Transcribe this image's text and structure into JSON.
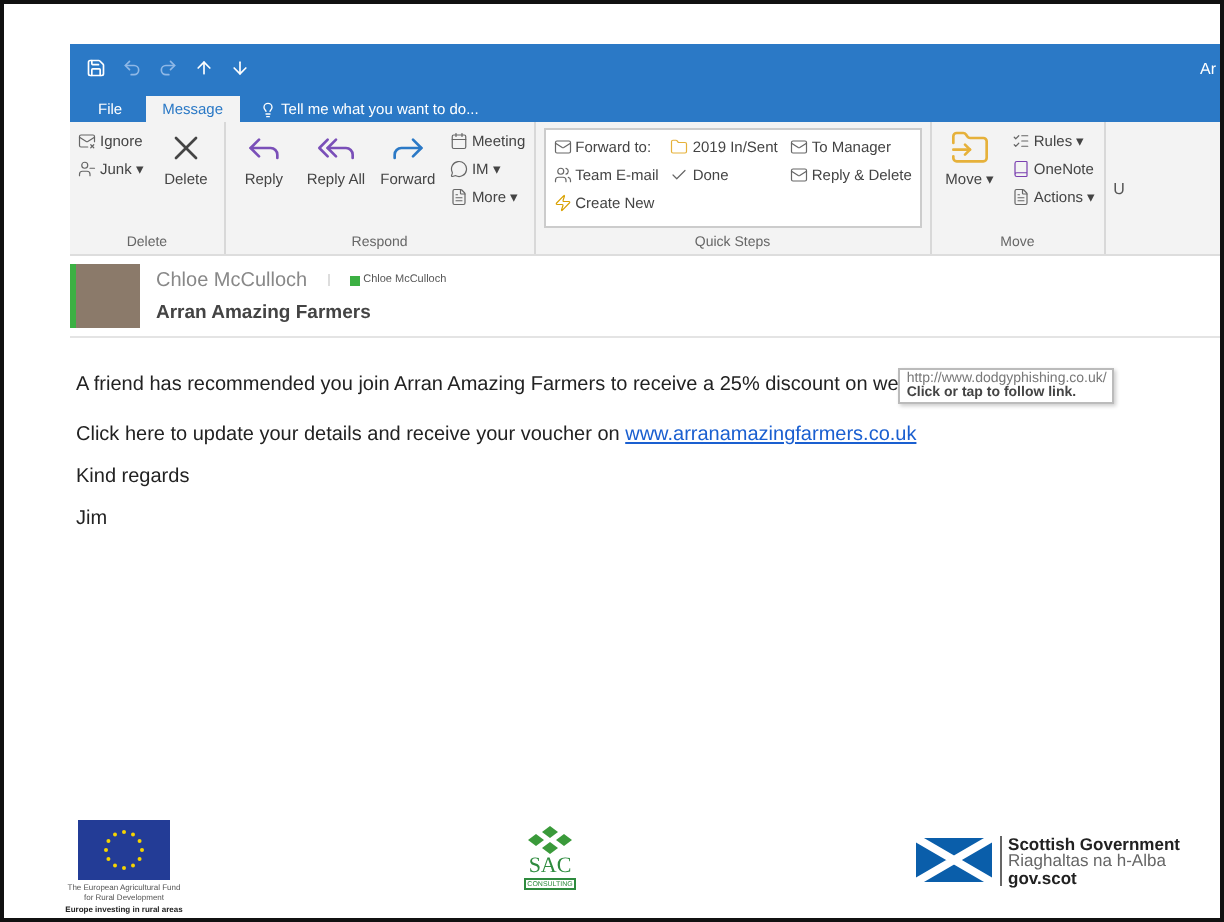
{
  "title_fragment": "Ar",
  "tabs": [
    {
      "label": "File",
      "selected": false
    },
    {
      "label": "Message",
      "selected": true
    }
  ],
  "tell_me": "Tell me what you want to do...",
  "ribbon_groups": [
    {
      "label": "Delete",
      "kind": "plain",
      "columns": [
        [
          {
            "label": "Ignore",
            "kind": "small"
          },
          {
            "label": "Junk ▾",
            "kind": "small"
          }
        ],
        [
          {
            "label": "Delete",
            "kind": "large"
          }
        ]
      ]
    },
    {
      "label": "Respond",
      "kind": "plain",
      "columns": [
        [
          {
            "label": "Reply",
            "kind": "large"
          }
        ],
        [
          {
            "label": "Reply All",
            "kind": "large"
          }
        ],
        [
          {
            "label": "Forward",
            "kind": "large"
          }
        ],
        [
          {
            "label": "Meeting",
            "kind": "small"
          },
          {
            "label": "IM ▾",
            "kind": "small"
          },
          {
            "label": "More ▾",
            "kind": "small"
          }
        ]
      ]
    },
    {
      "label": "Quick Steps",
      "kind": "gallery",
      "columns": [
        [
          {
            "label": "Forward to:",
            "kind": "small"
          },
          {
            "label": "Team E-mail",
            "kind": "small"
          },
          {
            "label": "Create New",
            "kind": "small"
          }
        ],
        [
          {
            "label": "2019 In/Sent",
            "kind": "small"
          },
          {
            "label": "Done",
            "kind": "small"
          }
        ],
        [
          {
            "label": "To Manager",
            "kind": "small"
          },
          {
            "label": "Reply & Delete",
            "kind": "small"
          }
        ]
      ]
    },
    {
      "label": "Move",
      "kind": "plain",
      "columns": [
        [
          {
            "label": "Move ▾",
            "kind": "large"
          }
        ],
        [
          {
            "label": "Rules ▾",
            "kind": "small"
          },
          {
            "label": "OneNote",
            "kind": "small"
          },
          {
            "label": "Actions ▾",
            "kind": "small"
          }
        ]
      ]
    }
  ],
  "cut_group_label": "U",
  "message": {
    "sender": "Chloe McCulloch",
    "presence_name": "Chloe McCulloch",
    "subject": "Arran Amazing Farmers",
    "paragraphs": [
      {
        "text": "A friend has recommended you join Arran Amazing Farmers to receive a 25% discount on we"
      },
      {
        "text": "Click here to update your details and receive your voucher on ",
        "link": "www.arranamazingfarmers.co.uk"
      },
      {
        "text": "Kind regards"
      },
      {
        "text": "Jim"
      }
    ]
  },
  "tooltip": {
    "url": "http://www.dodgyphishing.co.uk/",
    "hint": "Click or tap to follow link."
  },
  "footer": {
    "eu_caption": "The European Agricultural Fund for Rural Development",
    "eu_slogan": "Europe investing in rural areas",
    "sac_name": "SAC",
    "sac_sub": "CONSULTING",
    "gov_lines": [
      "Scottish Government",
      "Riaghaltas na h-Alba",
      "gov.scot"
    ]
  }
}
